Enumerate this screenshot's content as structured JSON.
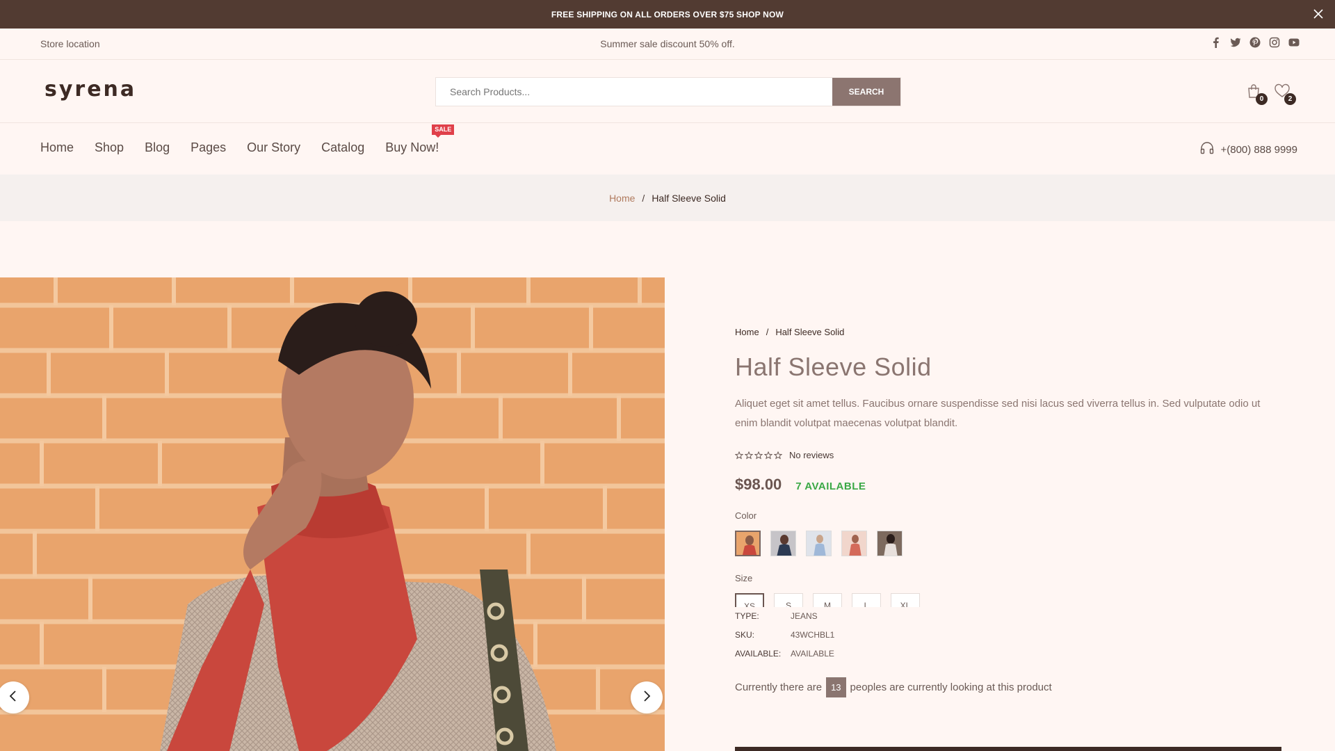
{
  "announcement": {
    "text": "FREE SHIPPING ON ALL ORDERS OVER $75 SHOP NOW"
  },
  "infobar": {
    "store_location": "Store location",
    "promo": "Summer sale discount 50% off."
  },
  "header": {
    "logo": "syrena",
    "search_placeholder": "Search Products...",
    "search_button": "SEARCH",
    "cart_count": "0",
    "wishlist_count": "2"
  },
  "nav": {
    "items": [
      {
        "label": "Home"
      },
      {
        "label": "Shop"
      },
      {
        "label": "Blog"
      },
      {
        "label": "Pages"
      },
      {
        "label": "Our Story"
      },
      {
        "label": "Catalog"
      },
      {
        "label": "Buy Now!"
      }
    ],
    "sale_badge": "SALE",
    "phone": "+(800) 888 9999"
  },
  "breadcrumb": {
    "home": "Home",
    "separator": "/",
    "current": "Half Sleeve Solid"
  },
  "product": {
    "crumb_home": "Home",
    "crumb_sep": "/",
    "crumb_current": "Half Sleeve Solid",
    "title": "Half Sleeve Solid",
    "description": "Aliquet eget sit amet tellus. Faucibus ornare suspendisse sed nisi lacus sed viverra tellus in. Sed vulputate odio ut enim blandit volutpat maecenas volutpat blandit.",
    "rating": 0,
    "reviews": "No reviews",
    "price": "$98.00",
    "availability": "7 AVAILABLE",
    "color_label": "Color",
    "size_label": "Size",
    "sizes": [
      "XS",
      "S",
      "M",
      "L",
      "XL"
    ],
    "meta": [
      {
        "key": "TYPE:",
        "value": "JEANS"
      },
      {
        "key": "SKU:",
        "value": "43WCHBL1"
      },
      {
        "key": "AVAILABLE:",
        "value": "AVAILABLE"
      }
    ],
    "viewers_prefix": "Currently there are",
    "viewers_count": "13",
    "viewers_suffix": "peoples are currently looking at this product"
  },
  "colors": {
    "topbar": "#523b32",
    "accent": "#8c7570",
    "available": "#3aa845",
    "sale": "#e0404a",
    "background": "#fff6f3"
  }
}
